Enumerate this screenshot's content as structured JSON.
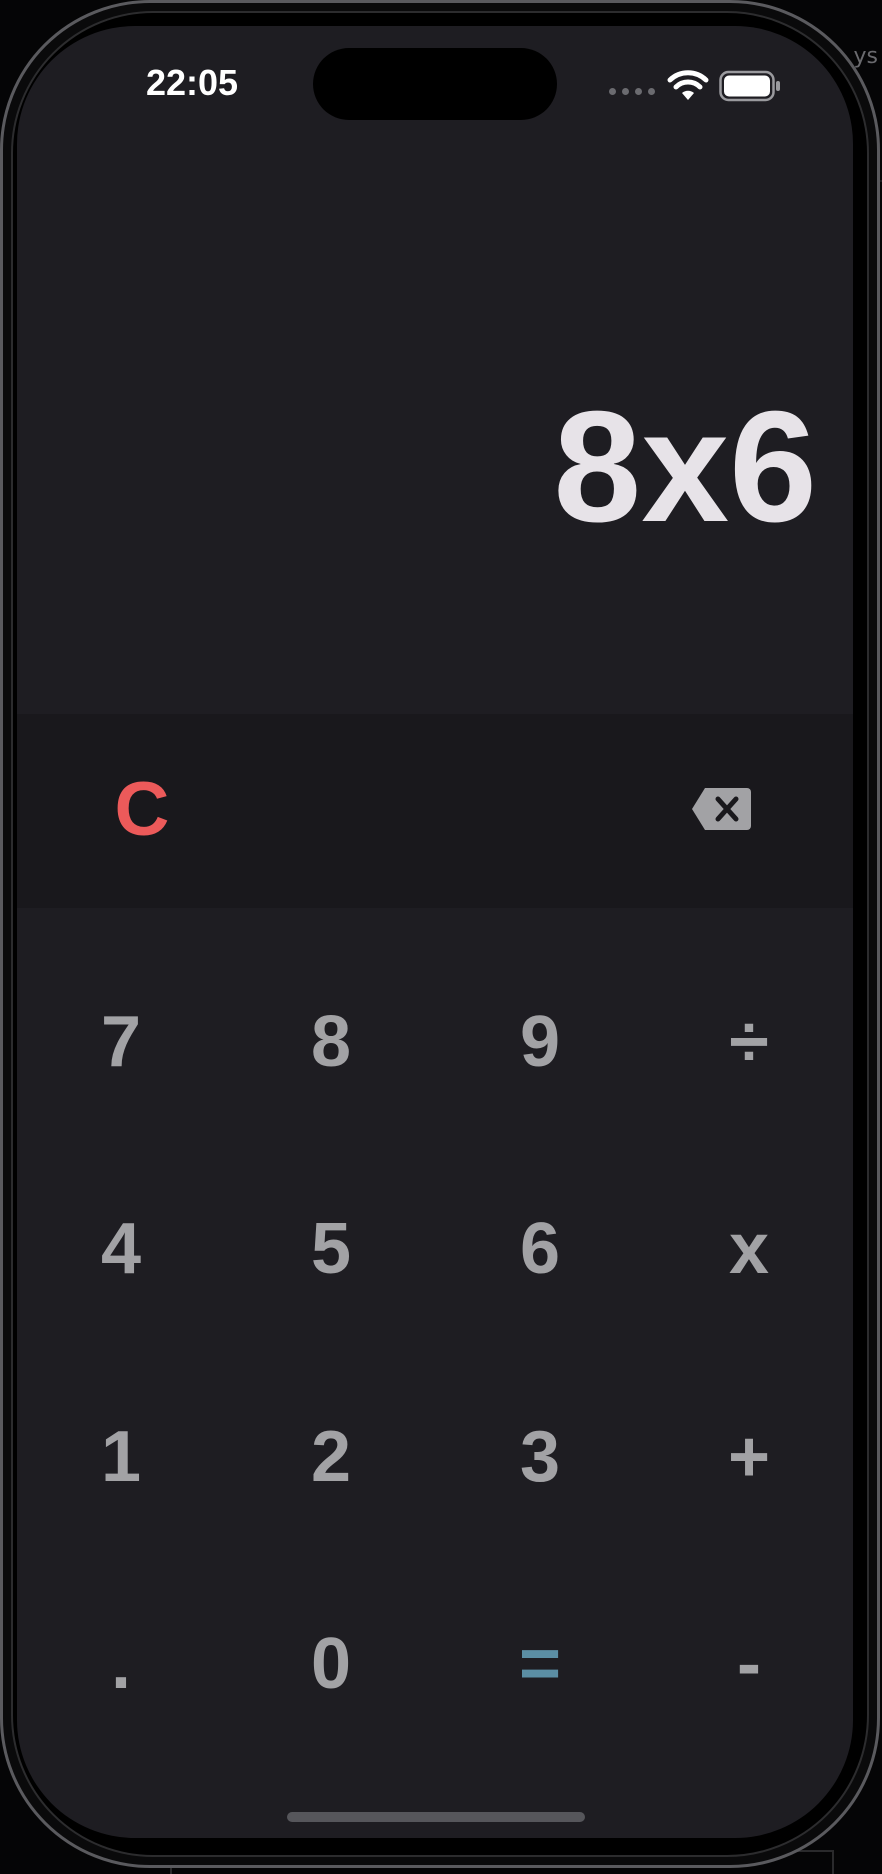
{
  "status_bar": {
    "time": "22:05",
    "icons": [
      "signal-dots-icon",
      "wifi-icon",
      "battery-icon"
    ]
  },
  "backdrop": {
    "edge_text": "ys"
  },
  "display": {
    "expression": "8x6"
  },
  "controls": {
    "clear_label": "C",
    "backspace_icon": "backspace-icon"
  },
  "keypad": {
    "keys": [
      {
        "label": "7",
        "type": "digit"
      },
      {
        "label": "8",
        "type": "digit"
      },
      {
        "label": "9",
        "type": "digit"
      },
      {
        "label": "÷",
        "type": "operator"
      },
      {
        "label": "4",
        "type": "digit"
      },
      {
        "label": "5",
        "type": "digit"
      },
      {
        "label": "6",
        "type": "digit"
      },
      {
        "label": "x",
        "type": "operator"
      },
      {
        "label": "1",
        "type": "digit"
      },
      {
        "label": "2",
        "type": "digit"
      },
      {
        "label": "3",
        "type": "digit"
      },
      {
        "label": "+",
        "type": "operator"
      },
      {
        "label": ".",
        "type": "decimal"
      },
      {
        "label": "0",
        "type": "digit"
      },
      {
        "label": "=",
        "type": "equals"
      },
      {
        "label": "-",
        "type": "operator"
      }
    ]
  },
  "colors": {
    "screen_bg": "#1e1d22",
    "control_row_bg": "#19181c",
    "display_text": "#e7e3e8",
    "key_text": "#a2a2a5",
    "clear_text": "#ec5a5a",
    "equals_text": "#5b8ea4"
  }
}
